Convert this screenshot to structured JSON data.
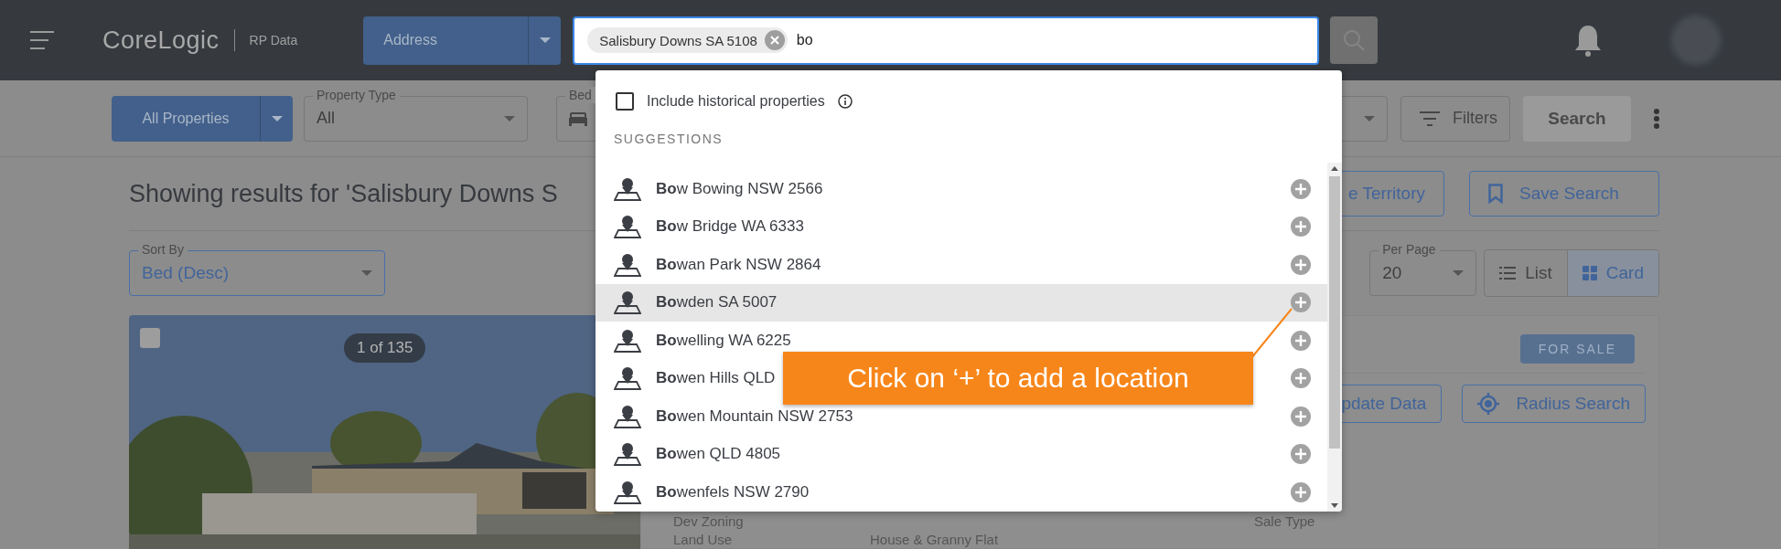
{
  "header": {
    "logo": "CoreLogic",
    "product": "RP Data",
    "search_type": "Address",
    "search_chip": "Salisbury Downs SA 5108",
    "search_value": "bo"
  },
  "filters": {
    "listing_type": "All Properties",
    "property_type": {
      "label": "Property Type",
      "value": "All"
    },
    "bedrooms_label": "Bed",
    "filters_button": "Filters",
    "search_button": {
      "label": "Search",
      "disabled": true
    }
  },
  "results": {
    "heading": "Showing results for 'Salisbury Downs S",
    "territory_button": "e Territory",
    "save_search_button": "Save Search",
    "sort_by": {
      "label": "Sort By",
      "value": "Bed (Desc)"
    },
    "per_page": {
      "label": "Per Page",
      "value": "20"
    },
    "views": [
      {
        "label": "List",
        "selected": false
      },
      {
        "label": "Card",
        "selected": true
      }
    ]
  },
  "card": {
    "checked": false,
    "photo_counter": "1 of 135",
    "status_badge": "FOR SALE",
    "buttons": [
      "pdate Data",
      "Radius Search"
    ],
    "details": [
      {
        "label": "Dev Zoning"
      },
      {
        "label": "Land Use",
        "value": "House & Granny Flat"
      }
    ],
    "right_label": "Sale Type"
  },
  "dropdown": {
    "include_historical": {
      "label": "Include historical properties",
      "checked": false
    },
    "section": "SUGGESTIONS",
    "suggestions": [
      {
        "text": "**Bo**w Bowing NSW 2566",
        "selected": false
      },
      {
        "text": "**Bo**w Bridge WA 6333",
        "selected": false
      },
      {
        "text": "**Bo**wan Park NSW 2864",
        "selected": false
      },
      {
        "text": "**Bo**wden SA 5007",
        "selected": true
      },
      {
        "text": "**Bo**welling WA 6225",
        "selected": false
      },
      {
        "text": "**Bo**wen Hills QLD",
        "selected": false
      },
      {
        "text": "**Bo**wen Mountain NSW 2753",
        "selected": false
      },
      {
        "text": "**Bo**wen QLD 4805",
        "selected": false
      },
      {
        "text": "**Bo**wenfels NSW 2790",
        "selected": false
      }
    ]
  },
  "callout": {
    "text": "Click on ‘+’ to add a location"
  }
}
